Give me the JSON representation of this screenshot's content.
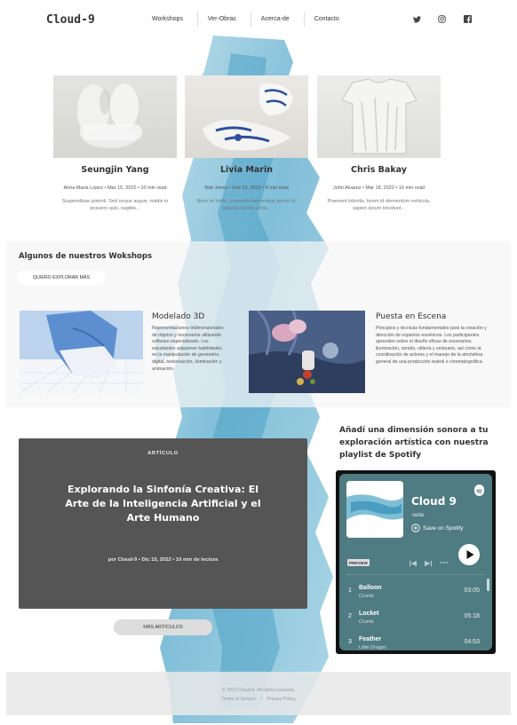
{
  "header": {
    "logo": "Cloud-9",
    "nav": [
      "Workshops",
      "Ver-Obras",
      "Acerca-de",
      "Contacto"
    ],
    "social_icons": [
      "twitter-icon",
      "instagram-icon",
      "facebook-icon"
    ]
  },
  "artists": [
    {
      "name": "Seungjin Yang",
      "meta": "Anna Maria Lopez  •  Mar 15, 2022  •  10 min read",
      "excerpt": "Suspendisse potenti. Sed neque augue, mattis in posuere quis, sagittis..."
    },
    {
      "name": "Livia Marin",
      "meta": "Bob Jones  •  Feb 18, 2022  •  8 min read",
      "excerpt": "Nunc mi tortor, venenatis fermentum ipsum id, gravida lacinia certa..."
    },
    {
      "name": "Chris Bakay",
      "meta": "John Alvarez  •  Mar 18, 2022  •  16 min read",
      "excerpt": "Praesent lobortis, lorem id elementum vehicula, sapien ipsum tincidunt..."
    }
  ],
  "workshops": {
    "title": "Algunos de nuestros Wokshops",
    "button": "QUIERO EXPLORAR MÁS",
    "items": [
      {
        "name": "Modelado 3D",
        "desc": "Representaciones tridimensionales de objetos y escenarios utilizando software especializado. Los estudiantes adquieren habilidades en la manipulación de geometría digital, texturización, iluminación y animación."
      },
      {
        "name": "Puesta en Escena",
        "desc": "Principios y técnicas fundamentales para la creación y dirección de espacios escénicos. Los participantes aprenden sobre el diseño eficaz de escenarios, iluminación, sonido, utilería y vestuario, así como la coordinación de actores y el manejo de la atmósfera general de una producción teatral o cinematográfica."
      }
    ]
  },
  "article": {
    "tag": "ARTÍCULO",
    "title": "Explorando la Sinfonía Creativa: El Arte de la Inteligencia Artificial y el Arte Humano",
    "meta": "por Cloud-9  •  Dic 15, 2022  •  10 min de lectura",
    "more_button": "MÁS ARTÍCULOS"
  },
  "spotify_section": {
    "heading": "Añadí una dimensión sonora a tu exploración artística con nuestra playlist de Spotify"
  },
  "spotify": {
    "playlist": "Cloud 9",
    "owner": "seda",
    "save": "Save on Spotify",
    "preview": "PREVIEW",
    "tracks": [
      {
        "num": "1",
        "title": "Balloon",
        "artist": "Crumb",
        "duration": "03:05"
      },
      {
        "num": "2",
        "title": "Locket",
        "artist": "Crumb",
        "duration": "05:18"
      },
      {
        "num": "3",
        "title": "Feather",
        "artist": "Little Dragon",
        "duration": "04:53"
      }
    ],
    "colors": {
      "background": "#4f7b82",
      "frame": "#111111"
    }
  },
  "footer": {
    "copyright": "© 2023 Cloud-9.  All rights reserved.",
    "links": [
      "Terms of Service",
      "Privacy Policy"
    ],
    "separator": "•"
  }
}
